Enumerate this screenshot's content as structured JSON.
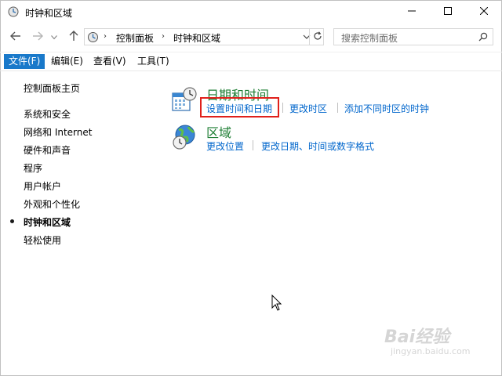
{
  "window": {
    "title": "时钟和区域",
    "icons": {
      "app": "control-panel-clock-icon",
      "minimize": "minimize-icon",
      "maximize": "maximize-icon",
      "close": "close-icon"
    }
  },
  "nav": {
    "back_icon": "back-arrow-icon",
    "forward_icon": "forward-arrow-icon",
    "recent_icon": "chevron-down-icon",
    "up_icon": "up-arrow-icon"
  },
  "address": {
    "crumbs": [
      "控制面板",
      "时钟和区域"
    ],
    "refresh_icon": "refresh-icon",
    "dropdown_icon": "chevron-down-icon"
  },
  "search": {
    "placeholder": "搜索控制面板",
    "icon": "search-icon"
  },
  "menubar": {
    "items": [
      "文件(F)",
      "编辑(E)",
      "查看(V)",
      "工具(T)"
    ],
    "active_index": 0
  },
  "sidebar": {
    "items": [
      {
        "label": "控制面板主页"
      },
      {
        "label": "系统和安全"
      },
      {
        "label": "网络和 Internet"
      },
      {
        "label": "硬件和声音"
      },
      {
        "label": "程序"
      },
      {
        "label": "用户帐户"
      },
      {
        "label": "外观和个性化"
      },
      {
        "label": "时钟和区域",
        "current": true
      },
      {
        "label": "轻松使用"
      }
    ]
  },
  "main": {
    "categories": [
      {
        "title": "日期和时间",
        "icon": "calendar-clock-icon",
        "links": [
          "设置时间和日期",
          "更改时区",
          "添加不同时区的时钟"
        ]
      },
      {
        "title": "区域",
        "icon": "globe-clock-icon",
        "links": [
          "更改位置",
          "更改日期、时间或数字格式"
        ]
      }
    ]
  },
  "watermark": {
    "main": "Bai经验",
    "sub": "jingyan.baidu.com"
  },
  "colors": {
    "accent": "#1979ca",
    "link": "#0066cc",
    "category": "#1e7e34",
    "highlight": "#e0201b"
  }
}
